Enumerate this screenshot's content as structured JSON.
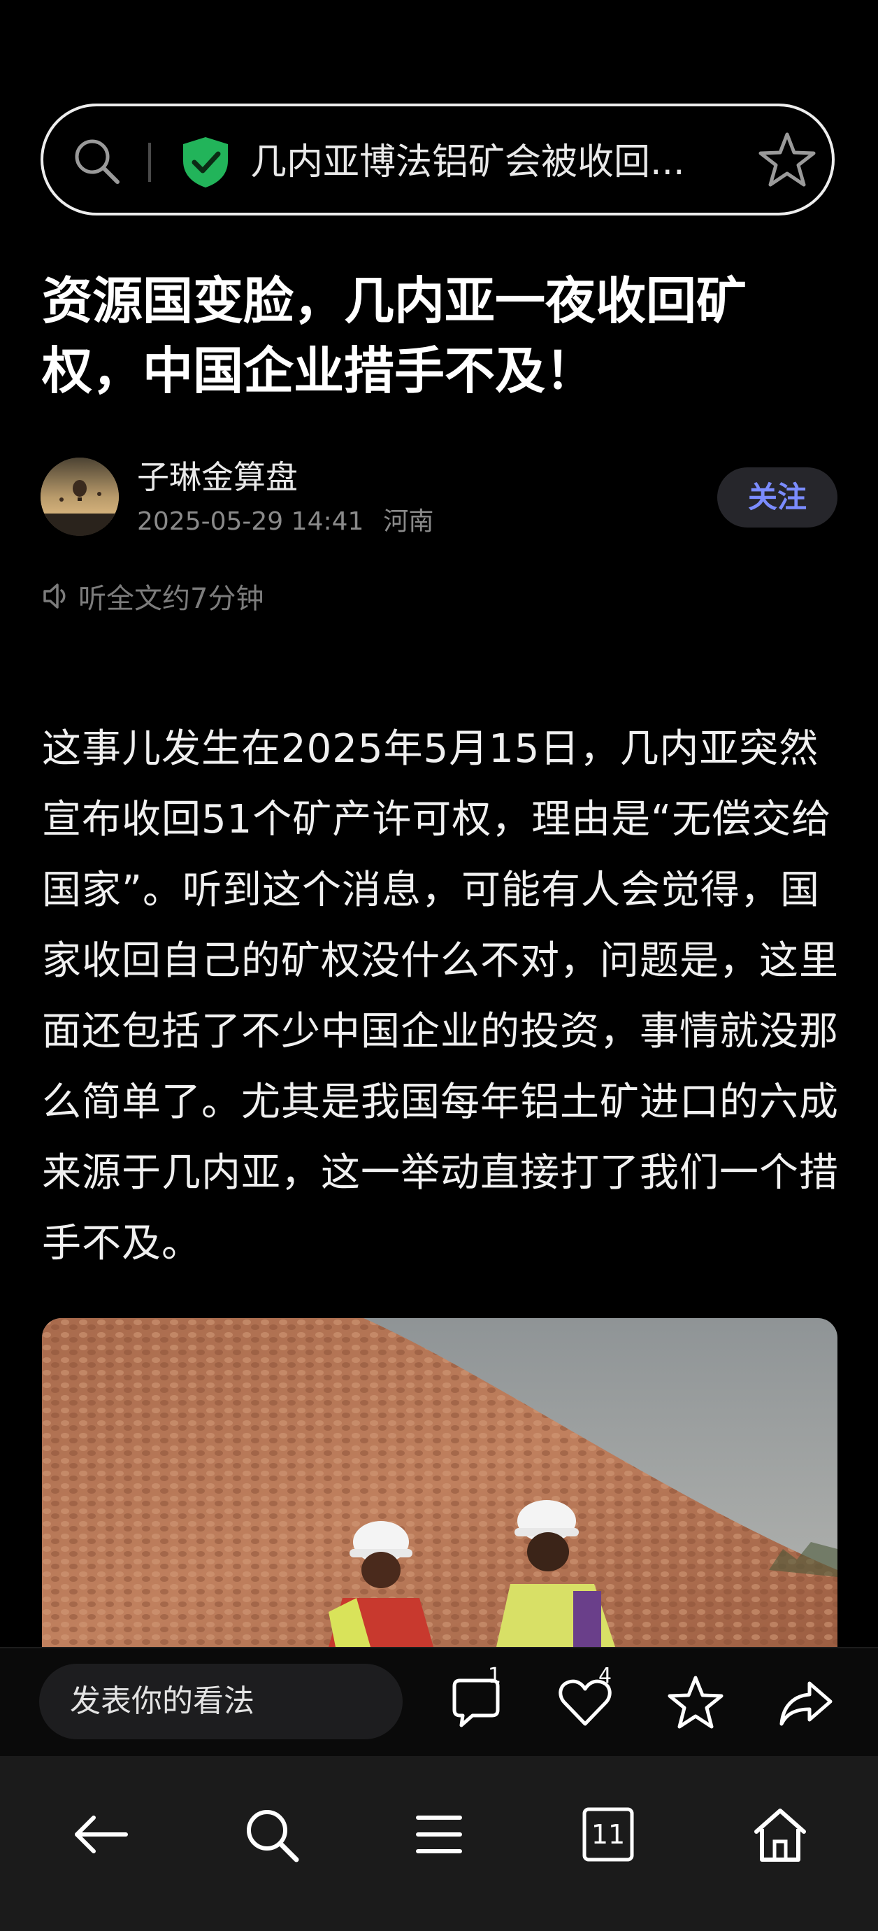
{
  "address_bar": {
    "url_text": "几内亚博法铝矿会被收回..."
  },
  "article": {
    "title": "资源国变脸，几内亚一夜收回矿权，中国企业措手不及！",
    "author": {
      "name": "子琳金算盘",
      "datetime": "2025-05-29 14:41",
      "region": "河南"
    },
    "follow_label": "关注",
    "listen_label": "听全文约7分钟",
    "body": "这事儿发生在2025年5月15日，几内亚突然宣布收回51个矿产许可权，理由是“无偿交给国家”。听到这个消息，可能有人会觉得，国家收回自己的矿权没什么不对，问题是，这里面还包括了不少中国企业的投资，事情就没那么简单了。尤其是我国每年铝土矿进口的六成来源于几内亚，这一举动直接打了我们一个措手不及。"
  },
  "comment_bar": {
    "placeholder": "发表你的看法",
    "comment_count": "1",
    "like_count": "4"
  },
  "system_nav": {
    "tabs_count": "11"
  },
  "colors": {
    "background": "#000000",
    "accent_follow": "#7b8cff",
    "shield_green": "#22b45a"
  }
}
